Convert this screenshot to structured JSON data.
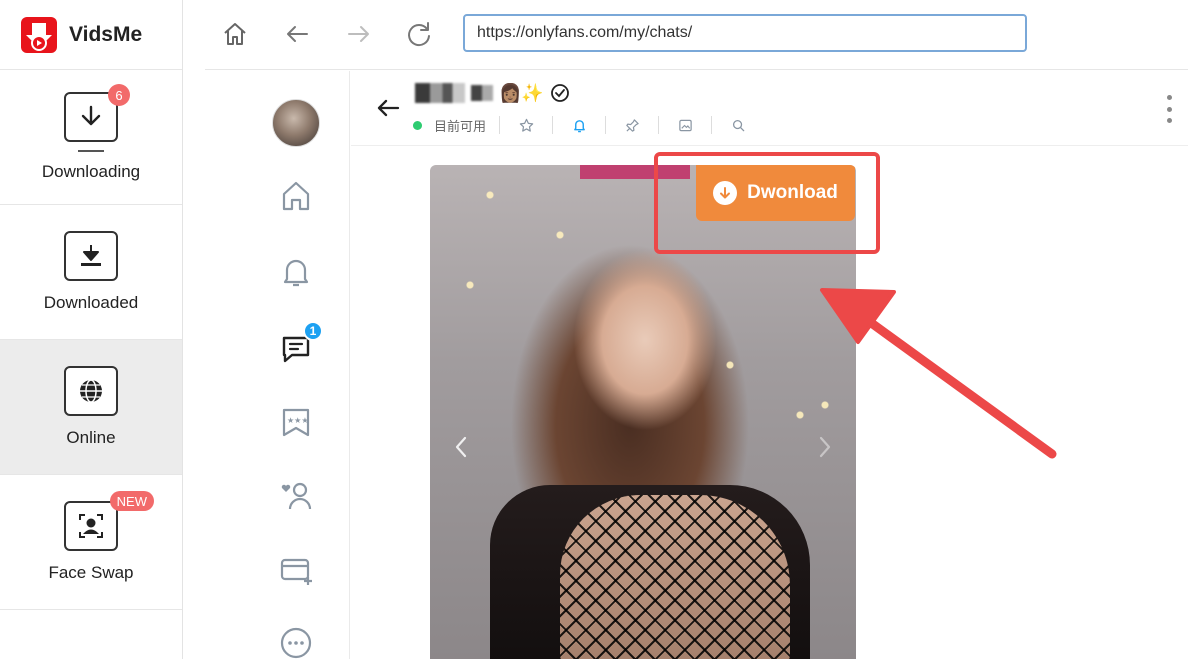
{
  "app": {
    "name": "VidsMe",
    "nav": [
      {
        "id": "downloading",
        "label": "Downloading",
        "badge": "6"
      },
      {
        "id": "downloaded",
        "label": "Downloaded"
      },
      {
        "id": "online",
        "label": "Online",
        "active": true
      },
      {
        "id": "face-swap",
        "label": "Face Swap",
        "badge": "NEW"
      }
    ]
  },
  "browser": {
    "url": "https://onlyfans.com/my/chats/"
  },
  "site": {
    "rail": {
      "messages_badge": "1"
    },
    "chat": {
      "name_emojis": "👩🏽✨",
      "status_text": "目前可用"
    },
    "download_button_label": "Dwonload"
  },
  "colors": {
    "accent_orange": "#f08a3c",
    "annotation_red": "#ec4848",
    "badge_red": "#f26a6a",
    "badge_blue": "#1da1f2",
    "online_green": "#2ecc71"
  }
}
